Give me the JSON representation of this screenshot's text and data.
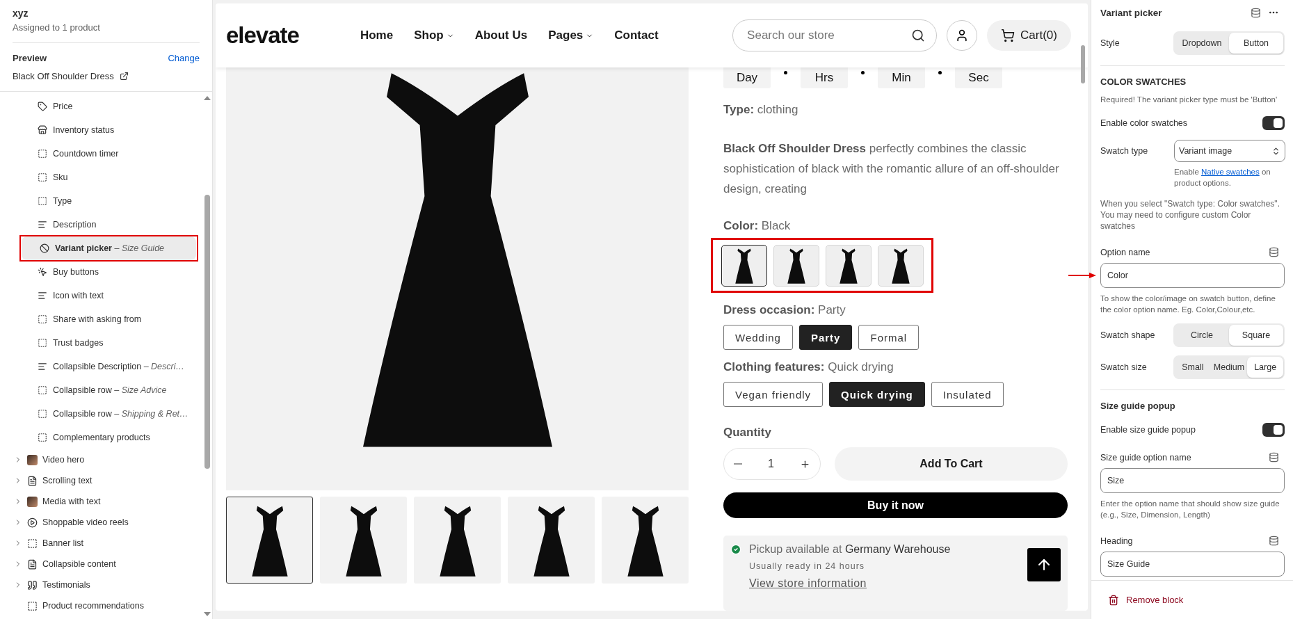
{
  "sidebar": {
    "title": "xyz",
    "subtitle": "Assigned to 1 product",
    "preview_label": "Preview",
    "change_link": "Change",
    "preview_product": "Black Off Shoulder Dress",
    "blocks": [
      {
        "kind": "price",
        "label": "Price",
        "selected": false,
        "annotated": false
      },
      {
        "kind": "inventory",
        "label": "Inventory status",
        "selected": false,
        "annotated": false
      },
      {
        "kind": "placeholder",
        "label": "Countdown timer",
        "selected": false,
        "annotated": false
      },
      {
        "kind": "placeholder",
        "label": "Sku",
        "selected": false,
        "annotated": false
      },
      {
        "kind": "placeholder",
        "label": "Type",
        "selected": false,
        "annotated": false
      },
      {
        "kind": "text",
        "label": "Description",
        "selected": false,
        "annotated": false
      },
      {
        "kind": "variant",
        "label": "Variant picker",
        "note": "– Size Guide",
        "selected": true,
        "annotated": true
      },
      {
        "kind": "buy",
        "label": "Buy buttons",
        "selected": false,
        "annotated": false
      },
      {
        "kind": "text",
        "label": "Icon with text",
        "selected": false,
        "annotated": false
      },
      {
        "kind": "placeholder",
        "label": "Share with asking from",
        "selected": false,
        "annotated": false
      },
      {
        "kind": "placeholder",
        "label": "Trust badges",
        "selected": false,
        "annotated": false
      },
      {
        "kind": "text",
        "label": "Collapsible Description",
        "note": "– Descri…",
        "selected": false,
        "annotated": false
      },
      {
        "kind": "placeholder",
        "label": "Collapsible row",
        "note": "– Size Advice",
        "selected": false,
        "annotated": false
      },
      {
        "kind": "placeholder",
        "label": "Collapsible row",
        "note": "– Shipping & Ret…",
        "selected": false,
        "annotated": false
      },
      {
        "kind": "placeholder",
        "label": "Complementary products",
        "selected": false,
        "annotated": false
      }
    ],
    "sections": [
      {
        "kind": "photo",
        "label": "Video hero",
        "expandable": true
      },
      {
        "kind": "text",
        "label": "Scrolling text",
        "expandable": true
      },
      {
        "kind": "photo",
        "label": "Media with text",
        "expandable": true
      },
      {
        "kind": "play",
        "label": "Shoppable video reels",
        "expandable": true
      },
      {
        "kind": "banner",
        "label": "Banner list",
        "expandable": true
      },
      {
        "kind": "text",
        "label": "Collapsible content",
        "expandable": true
      },
      {
        "kind": "quote",
        "label": "Testimonials",
        "expandable": true
      },
      {
        "kind": "banner",
        "label": "Product recommendations",
        "expandable": false
      }
    ]
  },
  "store": {
    "logo": "elevate",
    "nav": [
      {
        "label": "Home",
        "dropdown": false
      },
      {
        "label": "Shop",
        "dropdown": true
      },
      {
        "label": "About Us",
        "dropdown": false
      },
      {
        "label": "Pages",
        "dropdown": true
      },
      {
        "label": "Contact",
        "dropdown": false
      }
    ],
    "search": {
      "placeholder": "Search our store"
    },
    "cart": "Cart(0)",
    "thumbnails": [
      {
        "selected": true
      },
      {
        "selected": false
      },
      {
        "selected": false
      },
      {
        "selected": false
      },
      {
        "selected": false
      }
    ],
    "countdown": [
      "Day",
      "Hrs",
      "Min",
      "Sec"
    ],
    "type_label": "Type:",
    "type_value": "clothing",
    "description": "**Black Off Shoulder Dress** perfectly combines the classic sophistication of black with the romantic allure of an off-shoulder design, creating",
    "options": [
      {
        "kind": "swatch",
        "label": "Color:",
        "value": "Black",
        "annotated": true,
        "choices": [
          {
            "selected": true
          },
          {
            "selected": false
          },
          {
            "selected": false
          },
          {
            "selected": false
          }
        ]
      },
      {
        "kind": "button",
        "label": "Dress occasion:",
        "value": "Party",
        "choices": [
          {
            "label": "Wedding",
            "selected": false
          },
          {
            "label": "Party",
            "selected": true
          },
          {
            "label": "Formal",
            "selected": false
          }
        ]
      },
      {
        "kind": "button",
        "label": "Clothing features:",
        "value": "Quick drying",
        "choices": [
          {
            "label": "Vegan friendly",
            "selected": false
          },
          {
            "label": "Quick drying",
            "selected": true
          },
          {
            "label": "Insulated",
            "selected": false
          }
        ]
      }
    ],
    "quantity_label": "Quantity",
    "quantity": "1",
    "add_to_cart": "Add To Cart",
    "buy_now": "Buy it now",
    "pickup": {
      "available": true,
      "text": "Pickup available at",
      "location": "Germany Warehouse",
      "note": "Usually ready in 24 hours",
      "link": "View store information"
    }
  },
  "settings": {
    "title": "Variant picker",
    "items": [
      {
        "kind": "segmented",
        "label": "Style",
        "options": [
          {
            "label": "Dropdown",
            "selected": false
          },
          {
            "label": "Button",
            "selected": true
          }
        ]
      },
      {
        "kind": "divider"
      },
      {
        "kind": "heading",
        "text": "COLOR SWATCHES"
      },
      {
        "kind": "note",
        "text": "Required! The variant picker type must be 'Button'"
      },
      {
        "kind": "toggle",
        "label": "Enable color swatches",
        "on": true
      },
      {
        "kind": "select",
        "label": "Swatch type",
        "value": "Variant image",
        "help_before": "Enable",
        "help_link": "Native swatches",
        "help_after": "on product options."
      },
      {
        "kind": "paragraph",
        "text": "When you select \"Swatch type: Color swatches\". You may need to configure custom Color swatches"
      },
      {
        "kind": "input",
        "label": "Option name",
        "value": "Color",
        "help": "To show the color/image on swatch button, define the color option name. Eg. Color,Colour,etc.",
        "annotated": true
      },
      {
        "kind": "segmented",
        "label": "Swatch shape",
        "options": [
          {
            "label": "Circle",
            "selected": false
          },
          {
            "label": "Square",
            "selected": true
          }
        ]
      },
      {
        "kind": "segmented",
        "label": "Swatch size",
        "options": [
          {
            "label": "Small",
            "selected": false
          },
          {
            "label": "Medium",
            "selected": false
          },
          {
            "label": "Large",
            "selected": true
          }
        ]
      },
      {
        "kind": "divider"
      },
      {
        "kind": "heading",
        "text": "Size guide popup"
      },
      {
        "kind": "toggle",
        "label": "Enable size guide popup",
        "on": true
      },
      {
        "kind": "input",
        "label": "Size guide option name",
        "value": "Size",
        "help": "Enter the option name that should show size guide (e.g., Size, Dimension, Length)"
      },
      {
        "kind": "input",
        "label": "Heading",
        "value": "Size Guide"
      }
    ],
    "remove": "Remove block"
  }
}
